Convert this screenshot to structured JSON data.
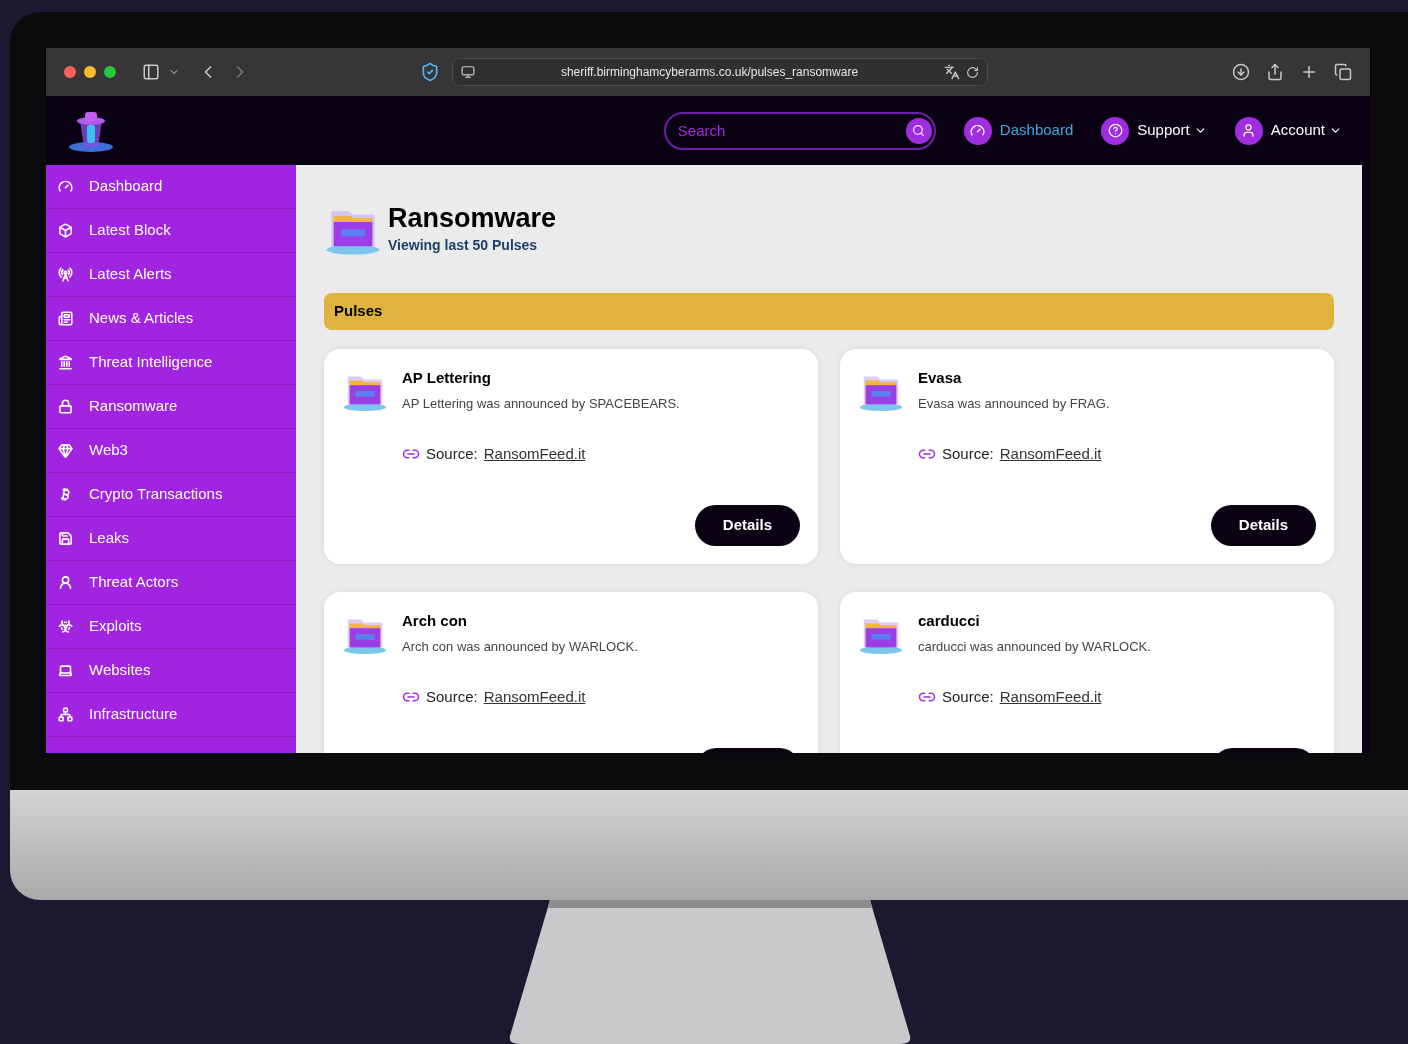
{
  "browser": {
    "url": "sheriff.birminghamcyberarms.co.uk/pulses_ransomware"
  },
  "header": {
    "search": {
      "placeholder": "Search"
    },
    "nav": [
      {
        "label": "Dashboard",
        "selected": true,
        "dropdown": false
      },
      {
        "label": "Support",
        "selected": false,
        "dropdown": true
      },
      {
        "label": "Account",
        "selected": false,
        "dropdown": true
      }
    ]
  },
  "sidebar": {
    "items": [
      {
        "label": "Dashboard"
      },
      {
        "label": "Latest Block"
      },
      {
        "label": "Latest Alerts"
      },
      {
        "label": "News & Articles"
      },
      {
        "label": "Threat Intelligence"
      },
      {
        "label": "Ransomware"
      },
      {
        "label": "Web3"
      },
      {
        "label": "Crypto Transactions"
      },
      {
        "label": "Leaks"
      },
      {
        "label": "Threat Actors"
      },
      {
        "label": "Exploits"
      },
      {
        "label": "Websites"
      },
      {
        "label": "Infrastructure"
      }
    ]
  },
  "page": {
    "title": "Ransomware",
    "subtitle": "Viewing last 50 Pulses"
  },
  "section": {
    "title": "Pulses"
  },
  "pulses": [
    {
      "name": "AP Lettering",
      "description": "AP Lettering was announced by SPACEBEARS.",
      "source_label": "Source:",
      "source_link": "RansomFeed.it",
      "button": "Details"
    },
    {
      "name": "Evasa",
      "description": "Evasa was announced by FRAG.",
      "source_label": "Source:",
      "source_link": "RansomFeed.it",
      "button": "Details"
    },
    {
      "name": "Arch con",
      "description": "Arch con was announced by WARLOCK.",
      "source_label": "Source:",
      "source_link": "RansomFeed.it"
    },
    {
      "name": "carducci",
      "description": "carducci was announced by WARLOCK.",
      "source_label": "Source:",
      "source_link": "RansomFeed.it"
    }
  ]
}
